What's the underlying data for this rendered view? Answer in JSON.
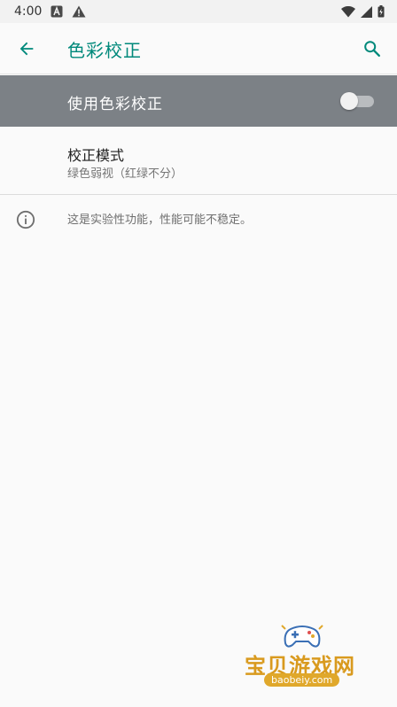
{
  "status_bar": {
    "time": "4:00",
    "icons_left": [
      "a-notification-icon",
      "warning-icon"
    ],
    "icons_right": [
      "wifi-icon",
      "cell-signal-icon",
      "battery-icon"
    ]
  },
  "app_bar": {
    "title": "色彩校正",
    "back_icon": "arrow-back-icon",
    "search_icon": "search-icon"
  },
  "master_switch": {
    "label": "使用色彩校正",
    "checked": false
  },
  "correction_mode": {
    "title": "校正模式",
    "summary": "绿色弱视（红绿不分）"
  },
  "footer": {
    "text": "这是实验性功能，性能可能不稳定。",
    "icon": "info-icon"
  },
  "watermark": {
    "title": "宝贝游戏网",
    "url": "baobeiy.com"
  },
  "colors": {
    "accent": "#00897b",
    "master_bar": "#7c8186",
    "background": "#fafafa"
  }
}
